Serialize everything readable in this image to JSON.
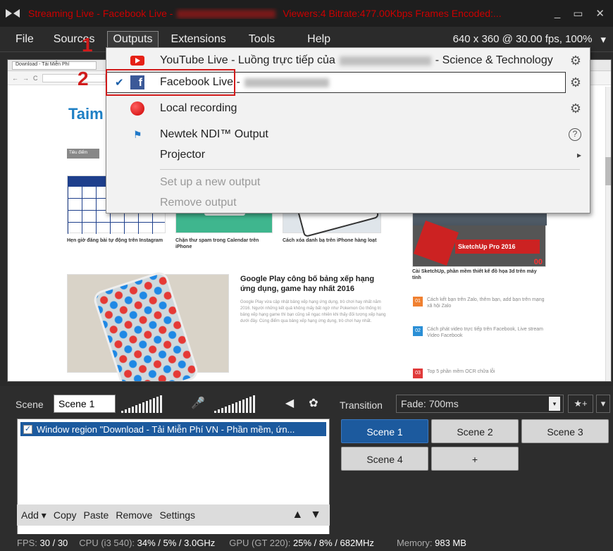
{
  "titlebar": {
    "app": "Streaming Live - Facebook Live -",
    "viewers": "Viewers:4",
    "bitrate": "Bitrate:477.00Kbps",
    "frames": "Frames Encoded:...",
    "min": "_",
    "max": "▭",
    "close": "✕"
  },
  "menu": {
    "file": "File",
    "sources": "Sources",
    "outputs": "Outputs",
    "extensions": "Extensions",
    "tools": "Tools",
    "help": "Help",
    "resolution": "640 x 360 @ 30.00 fps, 100%",
    "dropdown_arrow": "▾"
  },
  "steps": {
    "one": "1",
    "two": "2"
  },
  "outputs_menu": {
    "youtube": {
      "label": "YouTube Live - Luồng trực tiếp của",
      "suffix": "- Science & Technology",
      "icon": "youtube-icon"
    },
    "facebook": {
      "label": "Facebook Live -",
      "checked": "✔",
      "icon": "facebook-icon"
    },
    "local": {
      "label": "Local recording",
      "icon": "record-icon"
    },
    "ndi": {
      "label": "Newtek NDI™ Output",
      "icon": "ndi-icon",
      "help": "?"
    },
    "projector": {
      "label": "Projector",
      "arrow": "▸"
    },
    "setup": {
      "label": "Set up a new output"
    },
    "remove": {
      "label": "Remove output"
    },
    "gear": "⚙"
  },
  "preview": {
    "tab": "Download - Tải Miễn Phí",
    "logo": "Taim",
    "caption1": "Hẹn giờ đăng bài tự động trên Instagram",
    "caption2": "Chặn thư spam trong Calendar trên iPhone",
    "caption3": "Cách xóa danh bạ trên iPhone hàng loạt",
    "caption4": "Cài SketchUp, phần mềm thiết kế đồ họa 3d trên máy tính",
    "sketchup": "SketchUp Pro 2016",
    "article_title": "Google Play công bố bảng xếp hạng ứng dụng, game hay nhất 2016",
    "article_body": "Google Play vừa cập nhật bảng xếp hạng ứng dụng, trò chơi hay nhất năm 2016. Người những kết quả không mấy bất ngờ như Pokemon Go thống trị bảng xếp hạng game thì bạn cũng sẽ ngạc nhiên khi thấy đối tượng xếp hạng dưới đây. Cùng điểm qua bảng xếp hạng ứng dụng, trò chơi hay nhất.",
    "side1": "Cách kết bạn trên Zalo, thêm bạn, add bạn trên mạng xã hội Zalo",
    "side2": "Cách phát video trực tiếp trên Facebook, Live stream Video Facebook",
    "side3": "Top 5 phần mềm OCR chữa lỗi",
    "num1": "01",
    "num2": "02",
    "num3": "03",
    "tag": "Tiêu điểm",
    "label00": "00"
  },
  "scene": {
    "label": "Scene",
    "name": "Scene 1",
    "mic": "🎤",
    "speaker": "◀",
    "settings": "✿",
    "transition_label": "Transition",
    "transition_value": "Fade: 700ms",
    "add_icon": "★+",
    "arrow": "▾"
  },
  "sources_list": [
    {
      "name": "Window region \"Download - Tải Miễn Phí VN - Phần mềm, ứn...",
      "checked": "✓"
    }
  ],
  "source_bar": {
    "add": "Add ▾",
    "copy": "Copy",
    "paste": "Paste",
    "remove": "Remove",
    "settings": "Settings",
    "up": "▲",
    "down": "▼"
  },
  "scenes": [
    "Scene 1",
    "Scene 2",
    "Scene 3",
    "Scene 4",
    "+"
  ],
  "status": {
    "fps_label": "FPS:",
    "fps": "30 / 30",
    "cpu_label": "CPU (i3 540):",
    "cpu": "34% / 5% / 3.0GHz",
    "gpu_label": "GPU (GT 220):",
    "gpu": "25% / 8% / 682MHz",
    "mem_label": "Memory:",
    "mem": "983 MB"
  },
  "colors": {
    "accent": "#1c5a9e",
    "annotation": "#d01a1a"
  }
}
